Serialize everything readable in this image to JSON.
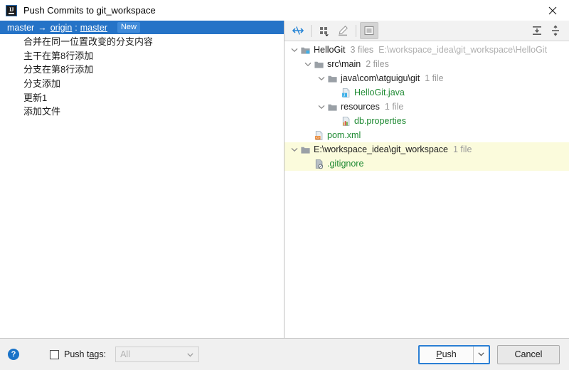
{
  "window": {
    "title": "Push Commits to git_workspace",
    "app_icon": "intellij-idea-icon",
    "close_icon": "close-icon"
  },
  "commits_panel": {
    "branch": {
      "local": "master",
      "arrow": "→",
      "remote": "origin",
      "separator": ":",
      "remote_branch": "master",
      "badge": "New"
    },
    "commits": [
      {
        "message": "合并在同一位置改变的分支内容"
      },
      {
        "message": "主干在第8行添加"
      },
      {
        "message": "分支在第8行添加"
      },
      {
        "message": "分支添加"
      },
      {
        "message": "更新1"
      },
      {
        "message": "添加文件"
      }
    ]
  },
  "tree_toolbar": {
    "buttons": [
      {
        "name": "diff-icon",
        "title": "Show Diff",
        "pressed": false
      },
      {
        "name": "group-by-icon",
        "title": "Group By",
        "pressed": false
      },
      {
        "name": "edit-source-icon",
        "title": "Edit Source",
        "pressed": false
      },
      {
        "name": "preview-icon",
        "title": "Preview Diff",
        "pressed": true
      },
      {
        "name": "expand-all-icon",
        "title": "Expand All",
        "pressed": false
      },
      {
        "name": "collapse-all-icon",
        "title": "Collapse All",
        "pressed": false
      }
    ]
  },
  "file_tree": {
    "rows": [
      {
        "indent": 0,
        "chevron": "expanded",
        "icon": "module-icon",
        "label": "HelloGit",
        "color": "default",
        "meta": "3 files",
        "path": "E:\\workspace_idea\\git_workspace\\HelloGit",
        "highlighted": false
      },
      {
        "indent": 1,
        "chevron": "expanded",
        "icon": "folder-icon",
        "label": "src\\main",
        "color": "default",
        "meta": "2 files",
        "path": "",
        "highlighted": false
      },
      {
        "indent": 2,
        "chevron": "expanded",
        "icon": "folder-icon",
        "label": "java\\com\\atguigu\\git",
        "color": "default",
        "meta": "1 file",
        "path": "",
        "highlighted": false
      },
      {
        "indent": 3,
        "chevron": "none",
        "icon": "java-file-icon",
        "label": "HelloGit.java",
        "color": "green",
        "meta": "",
        "path": "",
        "highlighted": false
      },
      {
        "indent": 2,
        "chevron": "expanded",
        "icon": "folder-icon",
        "label": "resources",
        "color": "default",
        "meta": "1 file",
        "path": "",
        "highlighted": false
      },
      {
        "indent": 3,
        "chevron": "none",
        "icon": "properties-file-icon",
        "label": "db.properties",
        "color": "green",
        "meta": "",
        "path": "",
        "highlighted": false
      },
      {
        "indent": 1,
        "chevron": "none",
        "icon": "xml-file-icon",
        "label": "pom.xml",
        "color": "green",
        "meta": "",
        "path": "",
        "highlighted": false
      },
      {
        "indent": 0,
        "chevron": "expanded",
        "icon": "folder-icon",
        "label": "E:\\workspace_idea\\git_workspace",
        "color": "default",
        "meta": "1 file",
        "path": "",
        "highlighted": true
      },
      {
        "indent": 1,
        "chevron": "none",
        "icon": "gitignore-file-icon",
        "label": ".gitignore",
        "color": "green",
        "meta": "",
        "path": "",
        "highlighted": true
      }
    ]
  },
  "footer": {
    "help_icon": "help-icon",
    "help_glyph": "?",
    "push_tags_label_pre": "Push t",
    "push_tags_label_mnemonic": "a",
    "push_tags_label_post": "gs:",
    "push_tags_checked": false,
    "tags_select_value": "All",
    "push_button_pre": "P",
    "push_button_mnemonic": "P",
    "push_button_label_rest": "ush",
    "push_dropdown_icon": "chevron-down-icon",
    "cancel_button": "Cancel"
  },
  "colors": {
    "selection_blue": "#2573c7",
    "badge_blue": "#3f8ad9",
    "added_green": "#1f8a33",
    "highlight_yellow": "#fbfbdc",
    "focus_blue": "#2a7fd4"
  }
}
